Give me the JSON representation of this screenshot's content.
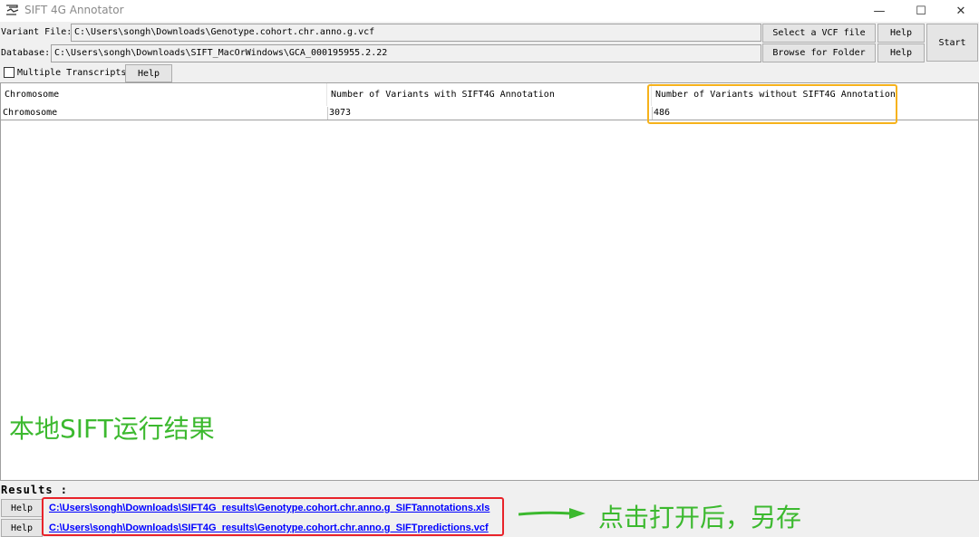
{
  "window": {
    "title": "SIFT 4G Annotator",
    "minimize": "—",
    "maximize": "☐",
    "close": "✕"
  },
  "form": {
    "variant_label": "Variant File:",
    "variant_value": "C:\\Users\\songh\\Downloads\\Genotype.cohort.chr.anno.g.vcf",
    "database_label": "Database:",
    "database_value": "C:\\Users\\songh\\Downloads\\SIFT_MacOrWindows\\GCA_000195955.2.22",
    "select_vcf_button": "Select a VCF file",
    "browse_folder_button": "Browse for Folder",
    "help_label": "Help",
    "start_button": "Start",
    "multiple_transcripts_label": "Multiple Transcripts",
    "multiple_transcripts_checked": false
  },
  "table": {
    "columns": [
      "Chromosome",
      "Number of Variants with SIFT4G Annotation",
      "Number of Variants without SIFT4G Annotation"
    ],
    "rows": [
      [
        "Chromosome",
        "3073",
        "486"
      ]
    ]
  },
  "annotations": {
    "local_result": "本地SIFT运行结果",
    "open_save": "点击打开后，另存"
  },
  "results": {
    "title": "Results :",
    "help_label": "Help",
    "files": [
      "C:\\Users\\songh\\Downloads\\SIFT4G_results\\Genotype.cohort.chr.anno.g_SIFTannotations.xls",
      "C:\\Users\\songh\\Downloads\\SIFT4G_results\\Genotype.cohort.chr.anno.g_SIFTpredictions.vcf"
    ]
  },
  "colors": {
    "annotation_green": "#3cb92f",
    "highlight_orange": "#f6b21b",
    "highlight_red": "#e8232a",
    "link_blue": "#0000ff"
  }
}
